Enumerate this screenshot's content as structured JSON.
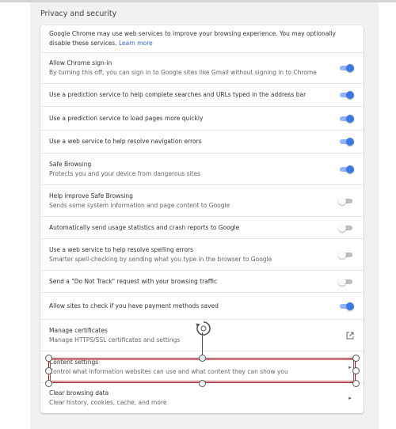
{
  "section": {
    "title": "Privacy and security"
  },
  "intro": {
    "text": "Google Chrome may use web services to improve your browsing experience. You may optionally disable these services.",
    "link": "Learn more"
  },
  "rows": [
    {
      "title": "Allow Chrome sign-in",
      "subtitle": "By turning this off, you can sign in to Google sites like Gmail without signing in to Chrome",
      "control": "toggle",
      "on": true
    },
    {
      "title": "Use a prediction service to help complete searches and URLs typed in the address bar",
      "subtitle": "",
      "control": "toggle",
      "on": true
    },
    {
      "title": "Use a prediction service to load pages more quickly",
      "subtitle": "",
      "control": "toggle",
      "on": true
    },
    {
      "title": "Use a web service to help resolve navigation errors",
      "subtitle": "",
      "control": "toggle",
      "on": true
    },
    {
      "title": "Safe Browsing",
      "subtitle": "Protects you and your device from dangerous sites",
      "control": "toggle",
      "on": true
    },
    {
      "title": "Help improve Safe Browsing",
      "subtitle": "Sends some system information and page content to Google",
      "control": "toggle",
      "on": false
    },
    {
      "title": "Automatically send usage statistics and crash reports to Google",
      "subtitle": "",
      "control": "toggle",
      "on": false
    },
    {
      "title": "Use a web service to help resolve spelling errors",
      "subtitle": "Smarter spell-checking by sending what you type in the browser to Google",
      "control": "toggle",
      "on": false
    },
    {
      "title": "Send a \"Do Not Track\" request with your browsing traffic",
      "subtitle": "",
      "control": "toggle",
      "on": false
    },
    {
      "title": "Allow sites to check if you have payment methods saved",
      "subtitle": "",
      "control": "toggle",
      "on": true
    },
    {
      "title": "Manage certificates",
      "subtitle": "Manage HTTPS/SSL certificates and settings",
      "control": "external-link-icon"
    },
    {
      "title": "Content settings",
      "subtitle": "Control what information websites can use and what content they can show you",
      "control": "arrow-right-icon"
    },
    {
      "title": "Clear browsing data",
      "subtitle": "Clear history, cookies, cache, and more",
      "control": "arrow-right-icon"
    }
  ],
  "colors": {
    "toggle_on": "#3b78e7",
    "toggle_on_track": "#8fb4f5",
    "toggle_off_track": "#bdbdbd",
    "link": "#3367d6",
    "selection": "#8b1a1a"
  },
  "overlay": {
    "rotate_icon": "rotate-handle-icon"
  }
}
